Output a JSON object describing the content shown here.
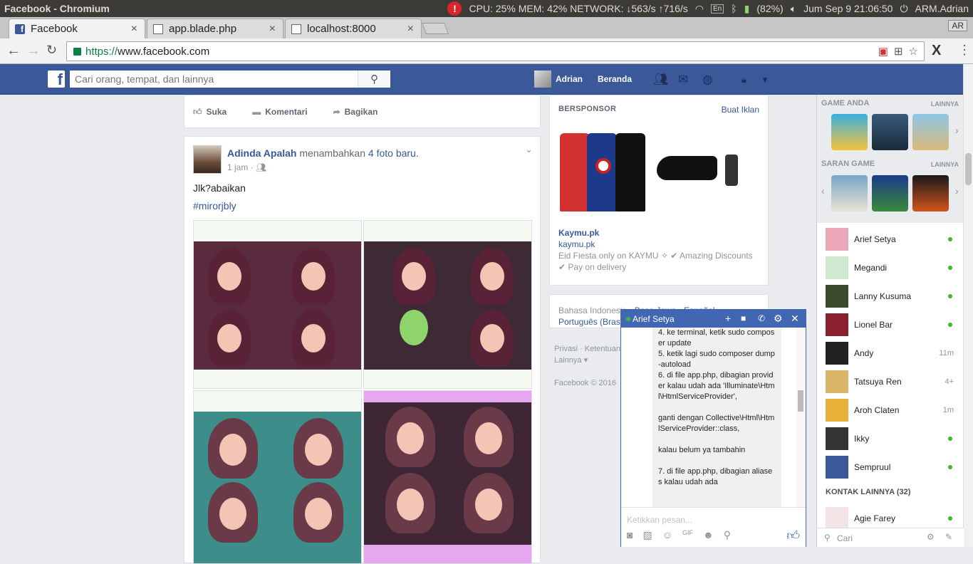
{
  "os": {
    "window_title": "Facebook - Chromium",
    "warn": "!",
    "stats": "CPU: 25% MEM: 42% NETWORK: ↓563/s ↑716/s",
    "lang": "En",
    "battery": "(82%)",
    "clock": "Jum Sep  9 21:06:50",
    "user": "ARM.Adrian"
  },
  "browser": {
    "tabs": [
      {
        "label": "Facebook",
        "close": "×"
      },
      {
        "label": "app.blade.php",
        "close": "×"
      },
      {
        "label": "localhost:8000",
        "close": "×"
      }
    ],
    "profile_badge": "AR",
    "url_scheme": "https://",
    "url_host": "www.facebook.com"
  },
  "fb": {
    "logo": "f",
    "search_placeholder": "Cari orang, tempat, dan lainnya",
    "user_name": "Adrian",
    "home": "Beranda"
  },
  "post_actions": {
    "like": "Suka",
    "comment": "Komentari",
    "share": "Bagikan"
  },
  "post": {
    "author": "Adinda Apalah",
    "verb": "menambahkan",
    "link": "4 foto baru.",
    "time": "1 jam · ",
    "text": "Jlk?abaikan",
    "hashtag": "#mirorjbly"
  },
  "ad": {
    "heading": "BERSPONSOR",
    "create": "Buat Iklan",
    "name": "Kaymu.pk",
    "url": "kaymu.pk",
    "desc": "Eid Fiesta only on KAYMU ✧ ✔ Amazing Discounts ✔ Pay on delivery"
  },
  "lang_box": {
    "current": "Bahasa Indonesia · ",
    "others": "Basa Jawa · Español · Português (Brasil)"
  },
  "footer": "Privasi · Ketentuan · Lainnya ▾\n\nFacebook © 2016",
  "games": {
    "your_games": "GAME ANDA",
    "more1": "LAINNYA",
    "suggest": "SARAN GAME",
    "more2": "LAINNYA"
  },
  "contacts": [
    {
      "name": "Arief Setya",
      "status": "online",
      "color": "#e9a7b8"
    },
    {
      "name": "Megandi",
      "status": "online",
      "color": "#cfe8cf"
    },
    {
      "name": "Lanny Kusuma",
      "status": "online",
      "color": "#3a4a2a"
    },
    {
      "name": "Lionel Bar",
      "status": "online",
      "color": "#8a2030"
    },
    {
      "name": "Andy",
      "status": "11m",
      "color": "#222222"
    },
    {
      "name": "Tatsuya Ren",
      "status": "4+",
      "color": "#d9b56a"
    },
    {
      "name": "Aroh Claten",
      "status": "1m",
      "color": "#e8b23a"
    },
    {
      "name": "Ikky",
      "status": "online",
      "color": "#333333"
    },
    {
      "name": "Sempruul",
      "status": "online",
      "color": "#3b5998"
    }
  ],
  "more_contacts": "KONTAK LAINNYA (32)",
  "extra_contact": {
    "name": "Agie Farey",
    "status": "online"
  },
  "chat_search": "Cari",
  "chat": {
    "name": "Arief Setya",
    "message": "4. ke terminal, ketik sudo composer update\n5. ketik lagi sudo composer dump-autoload\n6. di file app.php, dibagian provider kalau udah ada 'Illuminate\\Html\\HtmlServiceProvider',\n\nganti dengan Collective\\Html\\HtmlServiceProvider::class,\n\nkalau belum ya tambahin\n\n7. di file app.php, dibagian aliases kalau udah ada",
    "input_placeholder": "Ketikkan pesan..."
  }
}
